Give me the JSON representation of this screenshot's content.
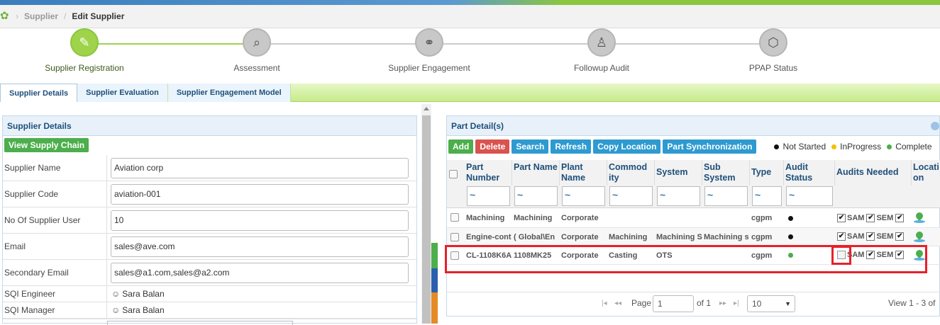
{
  "breadcrumb": {
    "root": "Supplier",
    "current": "Edit Supplier"
  },
  "wizard": {
    "steps": [
      {
        "label": "Supplier Registration",
        "icon": "clipboard-icon"
      },
      {
        "label": "Assessment",
        "icon": "magnifier-document-icon"
      },
      {
        "label": "Supplier Engagement",
        "icon": "handshake-icon"
      },
      {
        "label": "Followup Audit",
        "icon": "audit-team-icon"
      },
      {
        "label": "PPAP Status",
        "icon": "box-icon"
      }
    ]
  },
  "tabs": [
    "Supplier Details",
    "Supplier Evaluation",
    "Supplier Engagement Model"
  ],
  "supplier_details": {
    "title": "Supplier Details",
    "view_chain_button": "View Supply Chain",
    "fields": [
      {
        "label": "Supplier Name",
        "value": "Aviation corp"
      },
      {
        "label": "Supplier Code",
        "value": "aviation-001"
      },
      {
        "label": "No Of Supplier User",
        "value": "10"
      },
      {
        "label": "Email",
        "value": "sales@ave.com"
      },
      {
        "label": "Secondary Email",
        "value": "sales@a1.com,sales@a2.com"
      },
      {
        "label": "SQI Engineer",
        "value": "Sara Balan"
      },
      {
        "label": "SQI Manager",
        "value": "Sara Balan"
      }
    ]
  },
  "part_details": {
    "title": "Part Detail(s)",
    "buttons": {
      "add": "Add",
      "delete": "Delete",
      "search": "Search",
      "refresh": "Refresh",
      "copy_location": "Copy Location",
      "sync": "Part Synchronization"
    },
    "legend": {
      "not_started": "Not Started",
      "in_progress": "InProgress",
      "complete": "Complete"
    },
    "columns": {
      "part_number": "Part Number",
      "part_name": "Part Name",
      "plant_name": "Plant Name",
      "commodity": "Commod ity",
      "system": "System",
      "sub_system": "Sub System",
      "type": "Type",
      "audit_status": "Audit Status",
      "audits_needed": "Audits Needed",
      "location": "Locati on"
    },
    "filter_symbol": "~",
    "rows": [
      {
        "part_number": "Machining",
        "part_name": "Machining",
        "plant": "Corporate",
        "commodity": "",
        "system": "",
        "sub_system": "",
        "type": "cgpm",
        "status_color": "#111111",
        "sam_checked": true,
        "sam": "SAM",
        "sem": "SEM"
      },
      {
        "part_number": "Engine-cont",
        "part_name": "( Global\\En",
        "plant": "Corporate",
        "commodity": "Machining",
        "system": "Machining S",
        "sub_system": "Machining s",
        "type": "cgpm",
        "status_color": "#111111",
        "sam_checked": true,
        "sam": "SAM",
        "sem": "SEM"
      },
      {
        "part_number": "CL-1108K6A",
        "part_name": "1108MK25",
        "plant": "Corporate",
        "commodity": "Casting",
        "system": "OTS",
        "sub_system": "",
        "type": "cgpm",
        "status_color": "#4cae4c",
        "sam_checked": false,
        "sam": "SAM",
        "sem": "SEM"
      }
    ],
    "pager": {
      "page_label": "Page",
      "page": "1",
      "of_label": "of 1",
      "page_size": "10",
      "view_text": "View 1 - 3 of"
    }
  }
}
